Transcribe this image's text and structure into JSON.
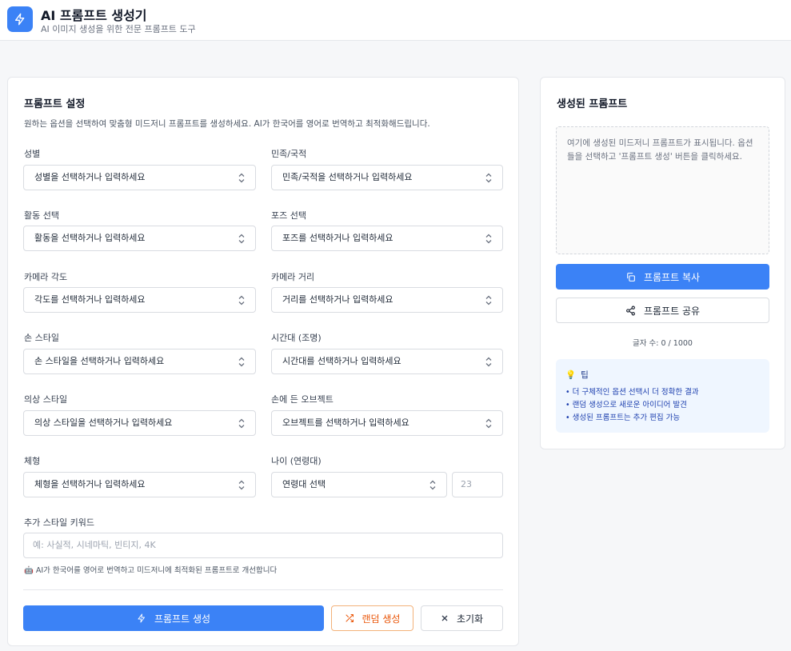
{
  "header": {
    "title": "AI 프롬프트 생성기",
    "subtitle": "AI 이미지 생성을 위한 전문 프롬프트 도구"
  },
  "settings": {
    "title": "프롬프트 설정",
    "description": "원하는 옵션을 선택하여 맞춤형 미드저니 프롬프트를 생성하세요. AI가 한국어를 영어로 번역하고 최적화해드립니다.",
    "fields": [
      {
        "label": "성별",
        "placeholder": "성별을 선택하거나 입력하세요"
      },
      {
        "label": "민족/국적",
        "placeholder": "민족/국적을 선택하거나 입력하세요"
      },
      {
        "label": "활동 선택",
        "placeholder": "활동을 선택하거나 입력하세요"
      },
      {
        "label": "포즈 선택",
        "placeholder": "포즈를 선택하거나 입력하세요"
      },
      {
        "label": "카메라 각도",
        "placeholder": "각도를 선택하거나 입력하세요"
      },
      {
        "label": "카메라 거리",
        "placeholder": "거리를 선택하거나 입력하세요"
      },
      {
        "label": "손 스타일",
        "placeholder": "손 스타일을 선택하거나 입력하세요"
      },
      {
        "label": "시간대 (조명)",
        "placeholder": "시간대를 선택하거나 입력하세요"
      },
      {
        "label": "의상 스타일",
        "placeholder": "의상 스타일을 선택하거나 입력하세요"
      },
      {
        "label": "손에 든 오브젝트",
        "placeholder": "오브젝트를 선택하거나 입력하세요"
      },
      {
        "label": "체형",
        "placeholder": "체형을 선택하거나 입력하세요"
      },
      {
        "label": "나이 (연령대)",
        "placeholder": "연령대 선택"
      }
    ],
    "age_placeholder": "23",
    "keywords": {
      "label": "추가 스타일 키워드",
      "placeholder": "예: 사실적, 시네마틱, 빈티지, 4K"
    },
    "hint": "AI가 한국어를 영어로 번역하고 미드저니에 최적화된 프롬프트로 개선합니다",
    "buttons": {
      "generate": "프롬프트 생성",
      "random": "랜덤 생성",
      "reset": "초기화"
    }
  },
  "output": {
    "title": "생성된 프롬프트",
    "placeholder": "여기에 생성된 미드저니 프롬프트가 표시됩니다. 옵션들을 선택하고 '프롬프트 생성' 버튼을 클릭하세요.",
    "copy_label": "프롬프트 복사",
    "share_label": "프롬프트 공유",
    "char_count": "글자 수: 0 / 1000",
    "tips": {
      "title": "팁",
      "items": [
        "• 더 구체적인 옵션 선택시 더 정확한 결과",
        "• 랜덤 생성으로 새로운 아이디어 발견",
        "• 생성된 프롬프트는 추가 편집 가능"
      ]
    }
  },
  "colors": {
    "accent": "#3b82f6",
    "random_accent": "#ea580c",
    "tips_bg": "#eff6ff"
  }
}
